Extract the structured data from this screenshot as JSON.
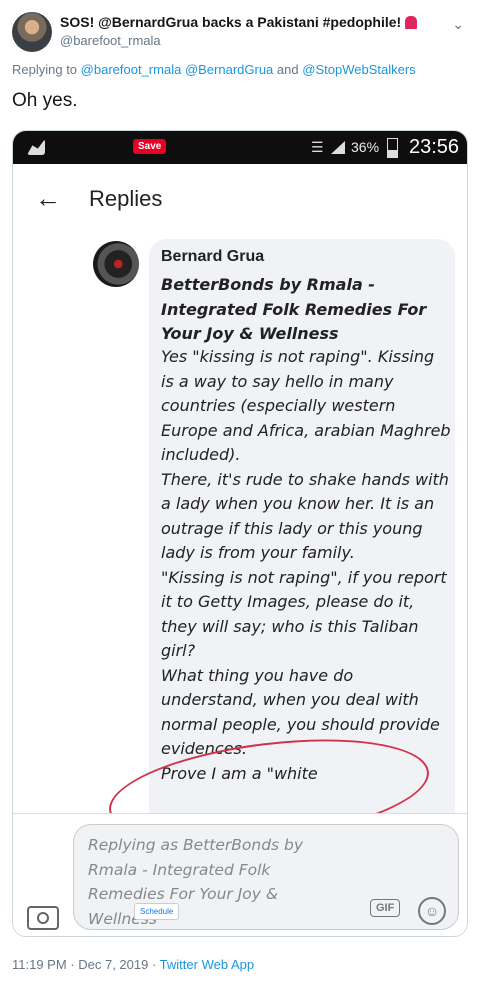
{
  "tweet": {
    "author_name": "SOS! @BernardGrua backs a Pakistani #pedophile!",
    "author_handle": "@barefoot_rmala",
    "replying_prefix": "Replying to",
    "replying_to_1": "@barefoot_rmala",
    "replying_to_2": "@BernardGrua",
    "replying_and": "and",
    "replying_to_3": "@StopWebStalkers",
    "text": "Oh yes.",
    "time_date": "11:19 PM · Dec 7, 2019 ·",
    "source": "Twitter Web App",
    "menu_icon": "chevron-down-icon"
  },
  "screenshot": {
    "status_bar": {
      "save_label": "Save",
      "battery": "36%",
      "time": "23:56"
    },
    "header": {
      "back_icon": "back-arrow-icon",
      "title": "Replies"
    },
    "comment": {
      "author": "Bernard Grua",
      "subtitle": "BetterBonds by Rmala - Integrated Folk Remedies For Your Joy & Wellness",
      "paragraphs": [
        "Yes \"kissing is not raping\". Kissing is a way to say hello in many countries (especially western Europe and Africa, arabian Maghreb included).",
        "There, it's rude to shake hands with a lady when you know her. It is an outrage if this lady or this young lady is from your family.",
        "\"Kissing is not raping\", if you report it to Getty Images, please do it, they will say; who is this Taliban girl?",
        "What thing you have do understand, when you deal with normal people, you should provide evidences.",
        "Prove I am a \"white"
      ]
    },
    "composer": {
      "placeholder": "Replying as BetterBonds by Rmala - Integrated Folk Remedies For Your Joy & Wellness",
      "schedule_label": "Schedule",
      "gif_label": "GIF"
    },
    "accent_colors": {
      "circle": "#d0324a",
      "save": "#e60023",
      "link": "#1b95e0"
    }
  }
}
